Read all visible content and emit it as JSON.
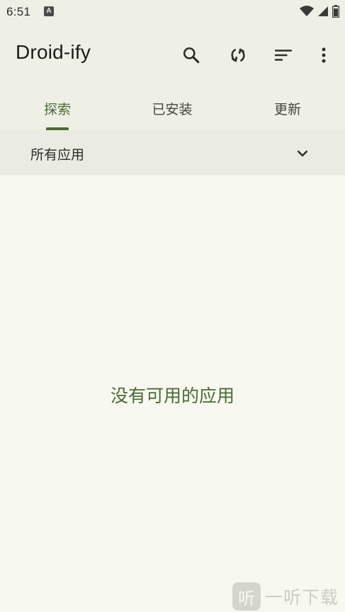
{
  "status_bar": {
    "time": "6:51",
    "notification_glyph": "A",
    "icons": [
      "wifi-icon",
      "signal-icon",
      "battery-icon"
    ]
  },
  "app_bar": {
    "title": "Droid-ify",
    "actions": [
      "search-icon",
      "sync-icon",
      "sort-icon",
      "more-vert-icon"
    ]
  },
  "tabs": [
    {
      "label": "探索",
      "active": true
    },
    {
      "label": "已安装",
      "active": false
    },
    {
      "label": "更新",
      "active": false
    }
  ],
  "filter": {
    "selected": "所有应用",
    "icon": "chevron-down-icon"
  },
  "empty_state": {
    "message": "没有可用的应用"
  },
  "watermark": {
    "logo_glyph": "听",
    "text": "一听下载"
  },
  "colors": {
    "accent": "#4A6A35",
    "surface": "#EEF0E6",
    "background": "#F7F8F0"
  }
}
